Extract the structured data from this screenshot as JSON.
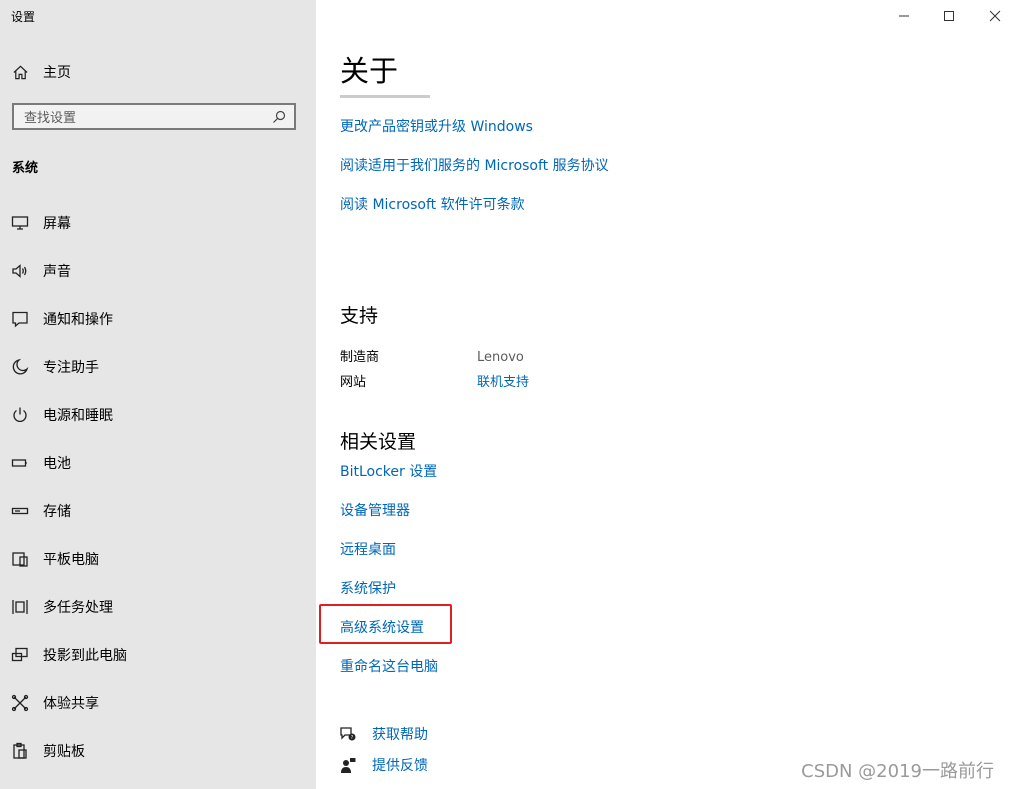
{
  "app_title": "设置",
  "sidebar": {
    "home_label": "主页",
    "search_placeholder": "查找设置",
    "group_label": "系统",
    "items": [
      {
        "label": "屏幕",
        "icon": "monitor-icon"
      },
      {
        "label": "声音",
        "icon": "speaker-icon"
      },
      {
        "label": "通知和操作",
        "icon": "notification-icon"
      },
      {
        "label": "专注助手",
        "icon": "moon-icon"
      },
      {
        "label": "电源和睡眠",
        "icon": "power-icon"
      },
      {
        "label": "电池",
        "icon": "battery-icon"
      },
      {
        "label": "存储",
        "icon": "storage-icon"
      },
      {
        "label": "平板电脑",
        "icon": "tablet-icon"
      },
      {
        "label": "多任务处理",
        "icon": "multitask-icon"
      },
      {
        "label": "投影到此电脑",
        "icon": "project-icon"
      },
      {
        "label": "体验共享",
        "icon": "share-icon"
      },
      {
        "label": "剪贴板",
        "icon": "clipboard-icon"
      }
    ]
  },
  "window_controls": [
    "minimize-icon",
    "maximize-icon",
    "close-icon"
  ],
  "main": {
    "page_title": "关于",
    "top_links": [
      "更改产品密钥或升级 Windows",
      "阅读适用于我们服务的 Microsoft 服务协议",
      "阅读 Microsoft 软件许可条款"
    ],
    "support": {
      "title": "支持",
      "manufacturer_key": "制造商",
      "manufacturer_value": "Lenovo",
      "website_key": "网站",
      "website_value": "联机支持"
    },
    "related": {
      "title": "相关设置",
      "links": [
        "BitLocker 设置",
        "设备管理器",
        "远程桌面",
        "系统保护",
        "高级系统设置",
        "重命名这台电脑"
      ],
      "highlighted_link": "高级系统设置",
      "highlight_color": "#e02020"
    },
    "help": {
      "get_help": "获取帮助",
      "feedback": "提供反馈"
    }
  },
  "watermark": "CSDN @2019一路前行",
  "colors": {
    "sidebar_bg": "#e6e6e6",
    "link": "#0067b8",
    "content_bg": "#ffffff"
  }
}
